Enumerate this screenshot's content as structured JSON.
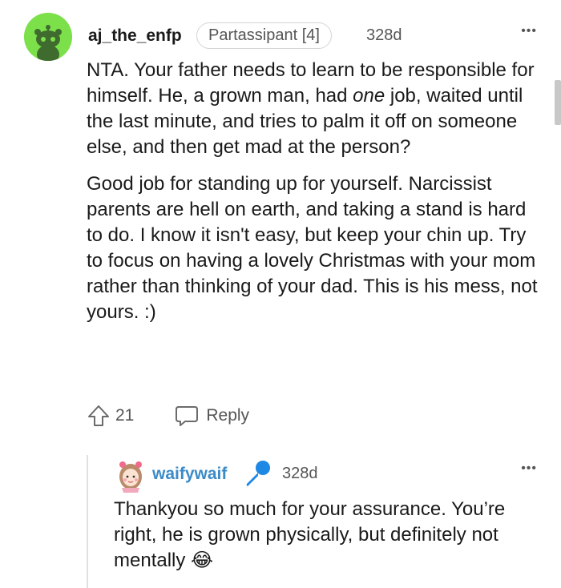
{
  "comment": {
    "username": "aj_the_enfp",
    "flair": "Partassipant [4]",
    "age": "328d",
    "more_label": "•••",
    "p1_before": "NTA. Your father needs to learn to be responsible for himself. He, a grown man, had ",
    "p1_em": "one",
    "p1_after": " job, waited until the last minute, and tries to palm it off on someone else, and then get mad at the person?",
    "p2": "Good job for standing up for yourself. Narcissist parents are hell on earth, and taking a stand is hard to do. I know it isn't easy, but keep your chin up. Try to focus on having a lovely Christmas with your mom rather than thinking of your dad. This is his mess, not yours. :)",
    "upvotes": "21",
    "reply_label": "Reply"
  },
  "reply": {
    "username": "waifywaif",
    "age": "328d",
    "more_label": "•••",
    "body": "Thankyou so much for your assurance. You’re right, he is grown physically, but definitely not mentally",
    "emoji": "😂"
  },
  "colors": {
    "avatar_green": "#7ce04a",
    "reply_username": "#3a8bc8",
    "mic_blue": "#1e88e5"
  },
  "icons": [
    "reddit-snoo-avatar-icon",
    "more-options-icon",
    "upvote-arrow-icon",
    "reply-bubble-icon",
    "microphone-icon",
    "tears-of-joy-emoji"
  ]
}
